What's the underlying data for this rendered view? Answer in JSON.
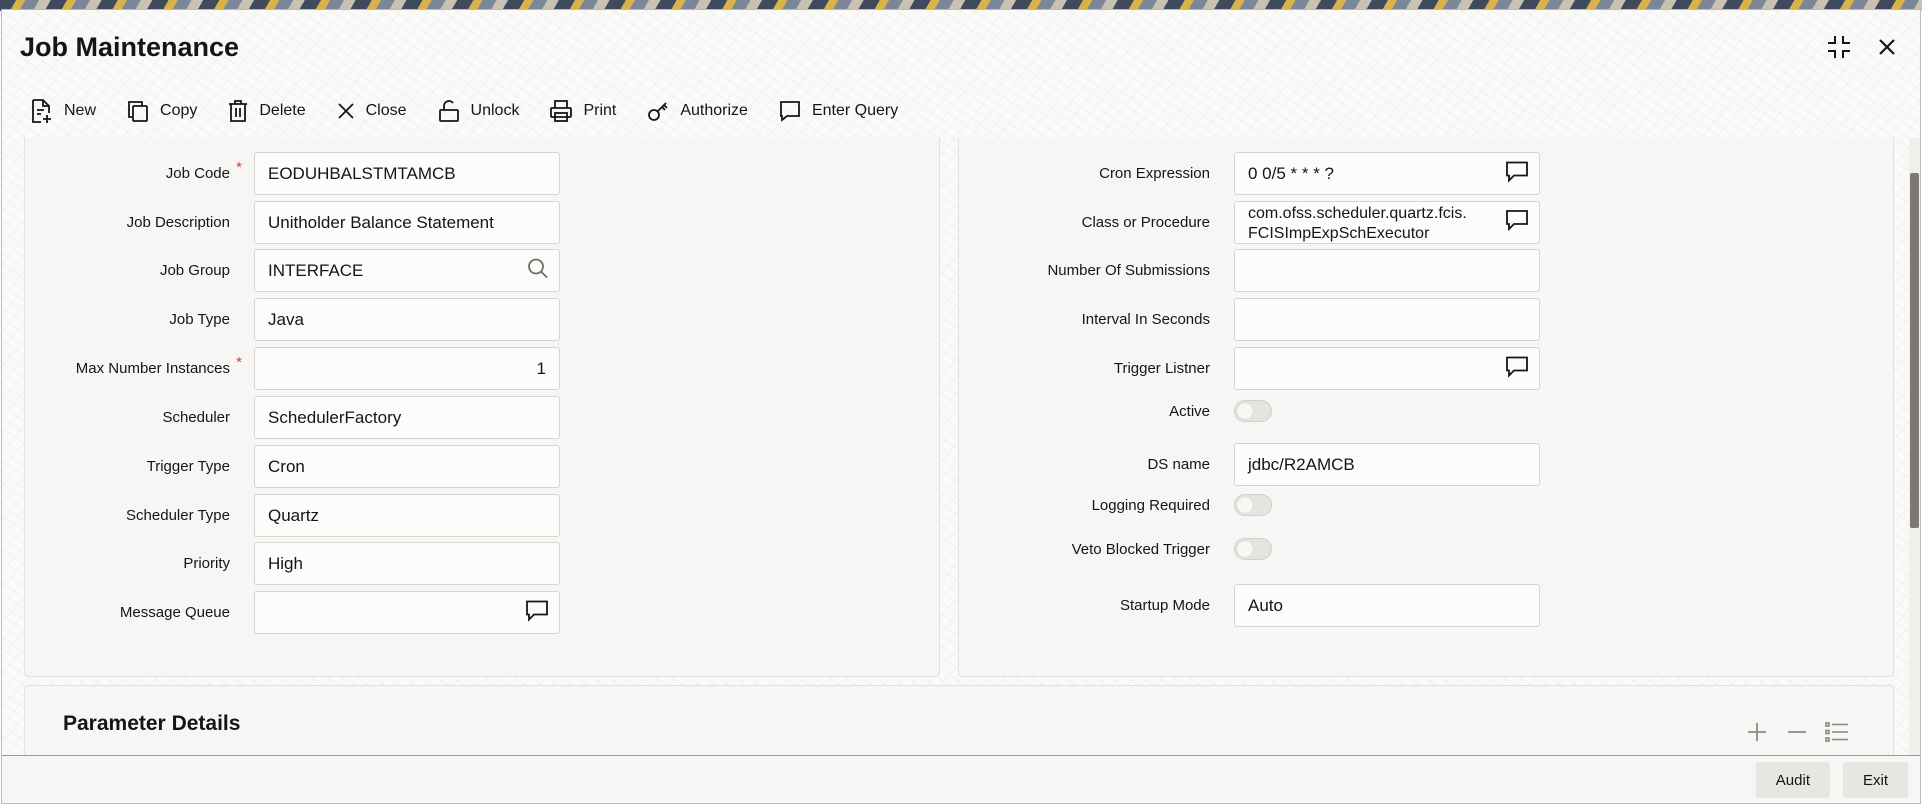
{
  "window": {
    "title": "Job Maintenance"
  },
  "toolbar": {
    "new": "New",
    "copy": "Copy",
    "delete": "Delete",
    "close": "Close",
    "unlock": "Unlock",
    "print": "Print",
    "authorize": "Authorize",
    "enter_query": "Enter Query"
  },
  "left": {
    "job_code": {
      "label": "Job Code",
      "value": "EODUHBALSTMTAMCB",
      "required": "*"
    },
    "job_description": {
      "label": "Job Description",
      "value": "Unitholder Balance Statement"
    },
    "job_group": {
      "label": "Job Group",
      "value": "INTERFACE"
    },
    "job_type": {
      "label": "Job Type",
      "value": "Java"
    },
    "max_instances": {
      "label": "Max Number Instances",
      "value": "1",
      "required": "*"
    },
    "scheduler": {
      "label": "Scheduler",
      "value": "SchedulerFactory"
    },
    "trigger_type": {
      "label": "Trigger Type",
      "value": "Cron"
    },
    "scheduler_type": {
      "label": "Scheduler Type",
      "value": "Quartz"
    },
    "priority": {
      "label": "Priority",
      "value": "High"
    },
    "message_queue": {
      "label": "Message Queue",
      "value": ""
    }
  },
  "right": {
    "cron_expression": {
      "label": "Cron Expression",
      "value": "0 0/5 * * * ?"
    },
    "class_or_procedure": {
      "label": "Class or Procedure",
      "line1": "com.ofss.scheduler.quartz.fcis.",
      "line2": "FCISImpExpSchExecutor"
    },
    "number_of_submissions": {
      "label": "Number Of Submissions",
      "value": ""
    },
    "interval_in_seconds": {
      "label": "Interval In Seconds",
      "value": ""
    },
    "trigger_listner": {
      "label": "Trigger Listner",
      "value": ""
    },
    "active": {
      "label": "Active",
      "checked": false
    },
    "ds_name": {
      "label": "DS name",
      "value": "jdbc/R2AMCB"
    },
    "logging_required": {
      "label": "Logging Required",
      "checked": false
    },
    "veto_blocked_trigger": {
      "label": "Veto Blocked Trigger",
      "checked": false
    },
    "startup_mode": {
      "label": "Startup Mode",
      "value": "Auto"
    }
  },
  "params": {
    "title": "Parameter Details"
  },
  "footer": {
    "audit": "Audit",
    "exit": "Exit"
  },
  "colors": {
    "required": "#c74634",
    "panel": "#f7f6f4",
    "field_border": "#d7d4cf"
  }
}
